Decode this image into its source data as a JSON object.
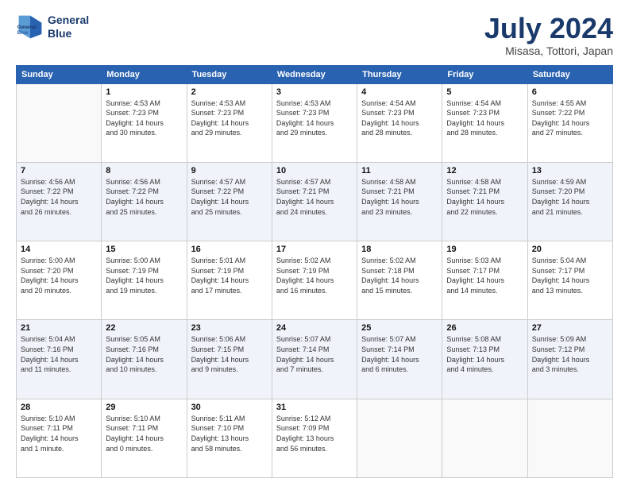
{
  "header": {
    "logo": {
      "line1": "General",
      "line2": "Blue"
    },
    "title": "July 2024",
    "location": "Misasa, Tottori, Japan"
  },
  "days_of_week": [
    "Sunday",
    "Monday",
    "Tuesday",
    "Wednesday",
    "Thursday",
    "Friday",
    "Saturday"
  ],
  "weeks": [
    [
      {
        "day": "",
        "info": ""
      },
      {
        "day": "1",
        "info": "Sunrise: 4:53 AM\nSunset: 7:23 PM\nDaylight: 14 hours\nand 30 minutes."
      },
      {
        "day": "2",
        "info": "Sunrise: 4:53 AM\nSunset: 7:23 PM\nDaylight: 14 hours\nand 29 minutes."
      },
      {
        "day": "3",
        "info": "Sunrise: 4:53 AM\nSunset: 7:23 PM\nDaylight: 14 hours\nand 29 minutes."
      },
      {
        "day": "4",
        "info": "Sunrise: 4:54 AM\nSunset: 7:23 PM\nDaylight: 14 hours\nand 28 minutes."
      },
      {
        "day": "5",
        "info": "Sunrise: 4:54 AM\nSunset: 7:23 PM\nDaylight: 14 hours\nand 28 minutes."
      },
      {
        "day": "6",
        "info": "Sunrise: 4:55 AM\nSunset: 7:22 PM\nDaylight: 14 hours\nand 27 minutes."
      }
    ],
    [
      {
        "day": "7",
        "info": "Sunrise: 4:56 AM\nSunset: 7:22 PM\nDaylight: 14 hours\nand 26 minutes."
      },
      {
        "day": "8",
        "info": "Sunrise: 4:56 AM\nSunset: 7:22 PM\nDaylight: 14 hours\nand 25 minutes."
      },
      {
        "day": "9",
        "info": "Sunrise: 4:57 AM\nSunset: 7:22 PM\nDaylight: 14 hours\nand 25 minutes."
      },
      {
        "day": "10",
        "info": "Sunrise: 4:57 AM\nSunset: 7:21 PM\nDaylight: 14 hours\nand 24 minutes."
      },
      {
        "day": "11",
        "info": "Sunrise: 4:58 AM\nSunset: 7:21 PM\nDaylight: 14 hours\nand 23 minutes."
      },
      {
        "day": "12",
        "info": "Sunrise: 4:58 AM\nSunset: 7:21 PM\nDaylight: 14 hours\nand 22 minutes."
      },
      {
        "day": "13",
        "info": "Sunrise: 4:59 AM\nSunset: 7:20 PM\nDaylight: 14 hours\nand 21 minutes."
      }
    ],
    [
      {
        "day": "14",
        "info": "Sunrise: 5:00 AM\nSunset: 7:20 PM\nDaylight: 14 hours\nand 20 minutes."
      },
      {
        "day": "15",
        "info": "Sunrise: 5:00 AM\nSunset: 7:19 PM\nDaylight: 14 hours\nand 19 minutes."
      },
      {
        "day": "16",
        "info": "Sunrise: 5:01 AM\nSunset: 7:19 PM\nDaylight: 14 hours\nand 17 minutes."
      },
      {
        "day": "17",
        "info": "Sunrise: 5:02 AM\nSunset: 7:19 PM\nDaylight: 14 hours\nand 16 minutes."
      },
      {
        "day": "18",
        "info": "Sunrise: 5:02 AM\nSunset: 7:18 PM\nDaylight: 14 hours\nand 15 minutes."
      },
      {
        "day": "19",
        "info": "Sunrise: 5:03 AM\nSunset: 7:17 PM\nDaylight: 14 hours\nand 14 minutes."
      },
      {
        "day": "20",
        "info": "Sunrise: 5:04 AM\nSunset: 7:17 PM\nDaylight: 14 hours\nand 13 minutes."
      }
    ],
    [
      {
        "day": "21",
        "info": "Sunrise: 5:04 AM\nSunset: 7:16 PM\nDaylight: 14 hours\nand 11 minutes."
      },
      {
        "day": "22",
        "info": "Sunrise: 5:05 AM\nSunset: 7:16 PM\nDaylight: 14 hours\nand 10 minutes."
      },
      {
        "day": "23",
        "info": "Sunrise: 5:06 AM\nSunset: 7:15 PM\nDaylight: 14 hours\nand 9 minutes."
      },
      {
        "day": "24",
        "info": "Sunrise: 5:07 AM\nSunset: 7:14 PM\nDaylight: 14 hours\nand 7 minutes."
      },
      {
        "day": "25",
        "info": "Sunrise: 5:07 AM\nSunset: 7:14 PM\nDaylight: 14 hours\nand 6 minutes."
      },
      {
        "day": "26",
        "info": "Sunrise: 5:08 AM\nSunset: 7:13 PM\nDaylight: 14 hours\nand 4 minutes."
      },
      {
        "day": "27",
        "info": "Sunrise: 5:09 AM\nSunset: 7:12 PM\nDaylight: 14 hours\nand 3 minutes."
      }
    ],
    [
      {
        "day": "28",
        "info": "Sunrise: 5:10 AM\nSunset: 7:11 PM\nDaylight: 14 hours\nand 1 minute."
      },
      {
        "day": "29",
        "info": "Sunrise: 5:10 AM\nSunset: 7:11 PM\nDaylight: 14 hours\nand 0 minutes."
      },
      {
        "day": "30",
        "info": "Sunrise: 5:11 AM\nSunset: 7:10 PM\nDaylight: 13 hours\nand 58 minutes."
      },
      {
        "day": "31",
        "info": "Sunrise: 5:12 AM\nSunset: 7:09 PM\nDaylight: 13 hours\nand 56 minutes."
      },
      {
        "day": "",
        "info": ""
      },
      {
        "day": "",
        "info": ""
      },
      {
        "day": "",
        "info": ""
      }
    ]
  ]
}
